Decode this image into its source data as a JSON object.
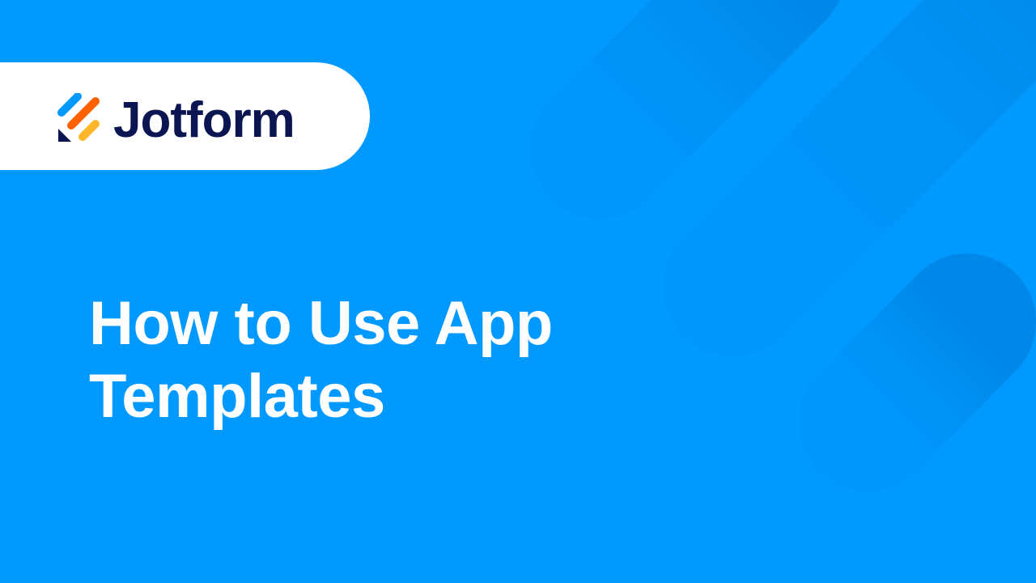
{
  "brand": {
    "name": "Jotform",
    "logo_icon": "jotform-logo-icon",
    "colors": {
      "background": "#0099ff",
      "wordmark": "#0a1551",
      "mark_blue": "#0099ff",
      "mark_orange": "#ff6100",
      "mark_yellow": "#ffb629",
      "mark_navy": "#0a1551"
    }
  },
  "title": {
    "line1": "How to Use App",
    "line2": "Templates"
  }
}
